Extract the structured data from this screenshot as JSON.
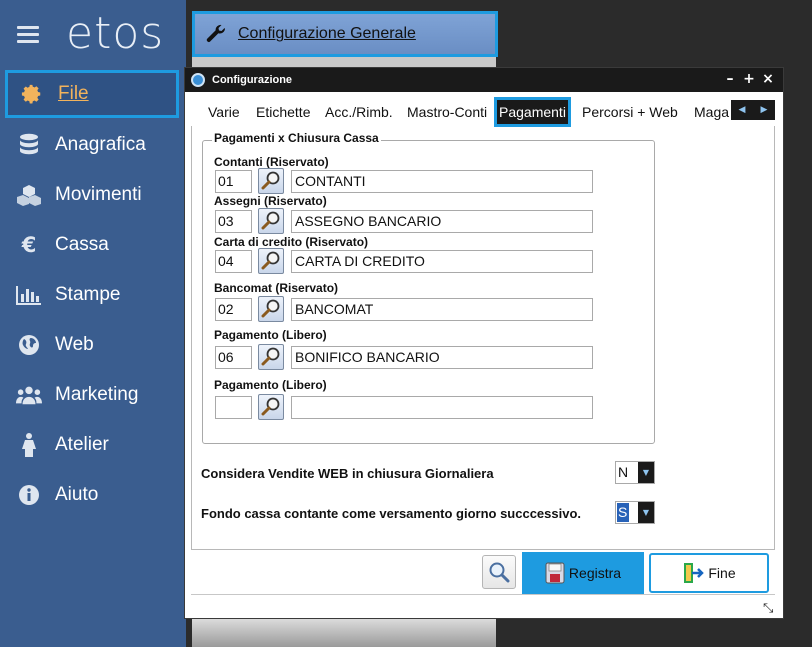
{
  "app": {
    "logo": "etos",
    "top_tab": "Configurazione Generale"
  },
  "sidebar": {
    "items": [
      {
        "label": "File",
        "icon": "gear-icon",
        "active": true
      },
      {
        "label": "Anagrafica",
        "icon": "database-icon"
      },
      {
        "label": "Movimenti",
        "icon": "cubes-icon"
      },
      {
        "label": "Cassa",
        "icon": "euro-icon"
      },
      {
        "label": "Stampe",
        "icon": "bar-chart-icon"
      },
      {
        "label": "Web",
        "icon": "globe-icon"
      },
      {
        "label": "Marketing",
        "icon": "users-icon"
      },
      {
        "label": "Atelier",
        "icon": "female-icon"
      },
      {
        "label": "Aiuto",
        "icon": "info-icon"
      }
    ]
  },
  "dialog": {
    "title": "Configurazione",
    "controls": {
      "minimize": "–",
      "maximize": "+",
      "close": "×"
    },
    "tabs": [
      "Varie",
      "Etichette",
      "Acc./Rimb.",
      "Mastro-Conti",
      "Pagamenti",
      "Percorsi + Web",
      "Maga"
    ],
    "active_tab": "Pagamenti",
    "group_title": "Pagamenti x Chiusura Cassa",
    "fields": [
      {
        "label": "Contanti (Riservato)",
        "code": "01",
        "desc": "CONTANTI"
      },
      {
        "label": "Assegni (Riservato)",
        "code": "03",
        "desc": "ASSEGNO BANCARIO"
      },
      {
        "label": "Carta di credito (Riservato)",
        "code": "04",
        "desc": "CARTA DI CREDITO"
      },
      {
        "label": "Bancomat (Riservato)",
        "code": "02",
        "desc": "BANCOMAT"
      },
      {
        "label": "Pagamento (Libero)",
        "code": "06",
        "desc": "BONIFICO BANCARIO"
      },
      {
        "label": "Pagamento (Libero)",
        "code": "",
        "desc": ""
      }
    ],
    "options": [
      {
        "label": "Considera Vendite WEB in chiusura Giornaliera",
        "value": "N"
      },
      {
        "label": "Fondo cassa contante come versamento giorno succcessivo.",
        "value": "S"
      }
    ],
    "buttons": {
      "registra": "Registra",
      "fine": "Fine"
    }
  },
  "colors": {
    "sidebar_bg": "#3a5d8f",
    "accent": "#1e9be0",
    "active_label": "#f2b35c"
  }
}
